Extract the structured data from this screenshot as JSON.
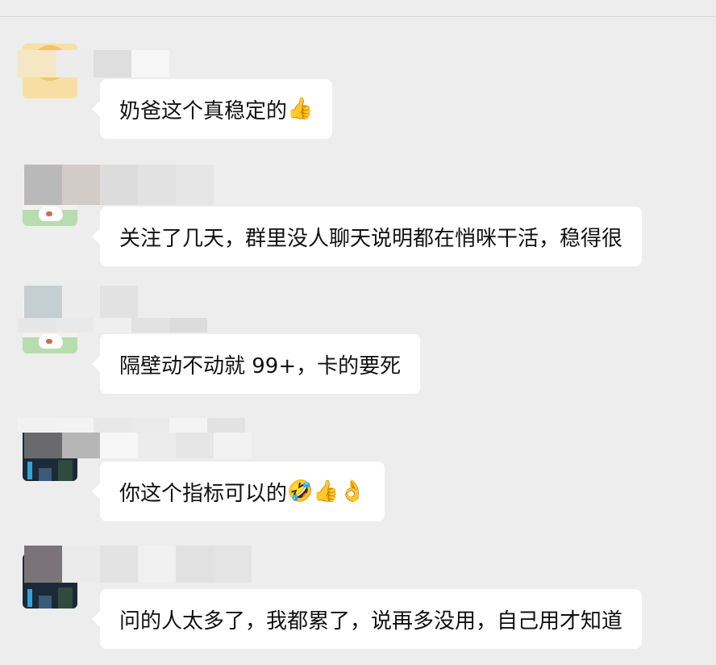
{
  "chat": {
    "messages": [
      {
        "id": 1,
        "avatar": "smiley-face",
        "text": "奶爸这个真稳定的",
        "emoji": "👍"
      },
      {
        "id": 2,
        "avatar": "cat-sticker",
        "text": "关注了几天，群里没人聊天说明都在悄咪干活，稳得很",
        "emoji": ""
      },
      {
        "id": 3,
        "avatar": "cat-sticker",
        "text": "隔壁动不动就 99+，卡的要死",
        "emoji": ""
      },
      {
        "id": 4,
        "avatar": "night-city",
        "text": "你这个指标可以的",
        "emoji": "🤣👍👌"
      },
      {
        "id": 5,
        "avatar": "night-city",
        "text": "问的人太多了，我都累了，说再多没用，自己用才知道",
        "emoji": ""
      }
    ]
  },
  "colors": {
    "background": "#ededed",
    "bubble": "#ffffff",
    "text": "#111111"
  }
}
